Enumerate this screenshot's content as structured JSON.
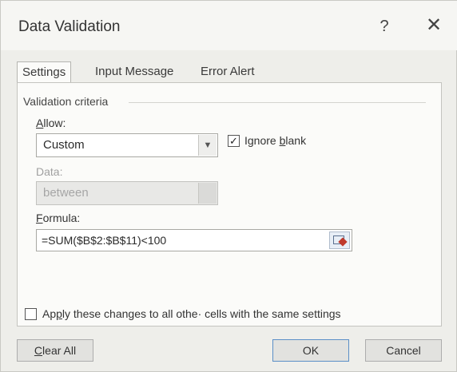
{
  "window": {
    "title": "Data Validation",
    "help_label": "?",
    "close_label": "✕"
  },
  "tabs": [
    {
      "label": "Settings",
      "active": true
    },
    {
      "label": "Input Message",
      "active": false
    },
    {
      "label": "Error Alert",
      "active": false
    }
  ],
  "criteria": {
    "group_label": "Validation criteria",
    "allow_label_u": "A",
    "allow_label_rest": "llow:",
    "allow_value": "Custom",
    "ignore_blank_checked": true,
    "ignore_blank_pre": "Ignore ",
    "ignore_blank_u": "b",
    "ignore_blank_post": "lank",
    "data_label": "Data:",
    "data_value": "between",
    "formula_label_u": "F",
    "formula_label_rest": "ormula:",
    "formula_value": "=SUM($B$2:$B$11)<100"
  },
  "apply_all": {
    "checked": false,
    "label_pre": "Ap",
    "label_u": "p",
    "label_post": "ly these changes to all othe· cells with the same settings"
  },
  "buttons": {
    "clear_u": "C",
    "clear_rest": "lear All",
    "ok": "OK",
    "cancel": "Cancel"
  },
  "icons": {
    "help": "help-icon",
    "close": "close-icon",
    "dropdown": "chevron-down-icon",
    "checkbox_checked": "checkmark-icon",
    "range_select": "range-select-icon"
  }
}
